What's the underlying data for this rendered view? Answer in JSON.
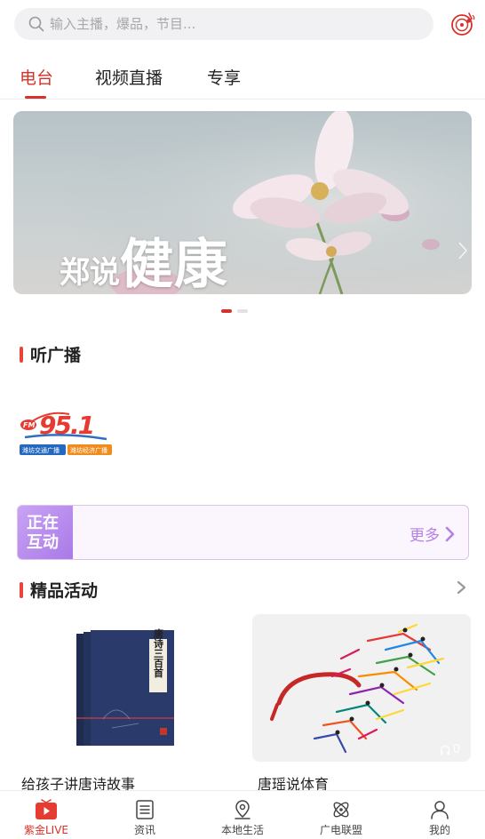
{
  "search": {
    "placeholder": "输入主播，爆品，节目..."
  },
  "tabs": [
    {
      "label": "电台"
    },
    {
      "label": "视频直播"
    },
    {
      "label": "专享"
    }
  ],
  "banner": {
    "title_small": "郑说",
    "title_big": "健康"
  },
  "sections": {
    "radio": {
      "title": "听广播"
    },
    "activities": {
      "title": "精品活动"
    }
  },
  "radio_logo": {
    "frequency": "95.1",
    "prefix": "FM",
    "tag1": "潍坊交通广播",
    "tag2": "潍坊经济广播"
  },
  "interact": {
    "badge_line1": "正在",
    "badge_line2": "互动",
    "more_label": "更多"
  },
  "activities": [
    {
      "title": "给孩子讲唐诗故事",
      "book_text": "唐诗三百首"
    },
    {
      "title": "唐瑶说体育",
      "play_count": "0"
    }
  ],
  "bottom_nav": [
    {
      "label": "紫金LIVE"
    },
    {
      "label": "资讯"
    },
    {
      "label": "本地生活"
    },
    {
      "label": "广电联盟"
    },
    {
      "label": "我的"
    }
  ],
  "colors": {
    "accent": "#d6312a",
    "interact": "#b581e4"
  }
}
